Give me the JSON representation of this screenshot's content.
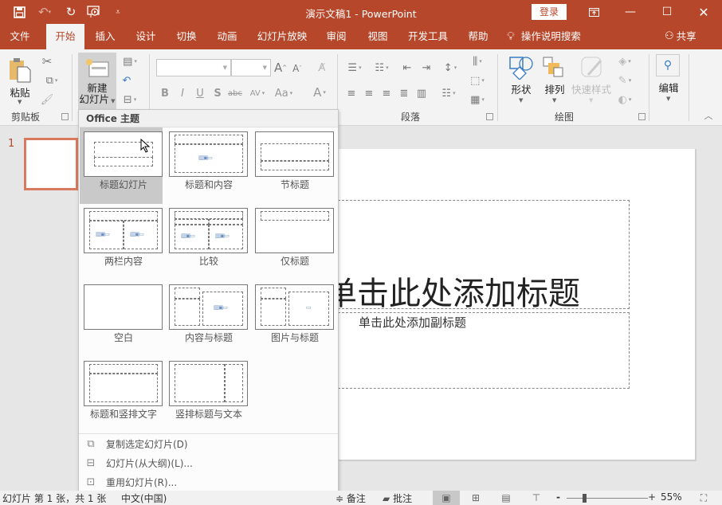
{
  "titlebar": {
    "document_title": "演示文稿1 - PowerPoint",
    "login_label": "登录",
    "qat": {
      "save": "save-icon",
      "undo": "undo-icon",
      "redo": "redo-icon",
      "present": "present-from-start-icon",
      "customize": "customize-qat-icon"
    },
    "window_buttons": {
      "ribbon_display": "ribbon-display-options-icon",
      "minimize": "minimize-icon",
      "maximize": "maximize-icon",
      "close": "close-icon"
    }
  },
  "tabs": [
    {
      "label": "文件",
      "active": false
    },
    {
      "label": "开始",
      "active": true
    },
    {
      "label": "插入",
      "active": false
    },
    {
      "label": "设计",
      "active": false
    },
    {
      "label": "切换",
      "active": false
    },
    {
      "label": "动画",
      "active": false
    },
    {
      "label": "幻灯片放映",
      "active": false
    },
    {
      "label": "审阅",
      "active": false
    },
    {
      "label": "视图",
      "active": false
    },
    {
      "label": "开发工具",
      "active": false
    },
    {
      "label": "帮助",
      "active": false
    }
  ],
  "tell_me": {
    "label": "操作说明搜索"
  },
  "share": {
    "label": "共享"
  },
  "ribbon": {
    "clipboard": {
      "group_label": "剪贴板",
      "paste_label": "粘贴"
    },
    "slides": {
      "new_slide_label_line1": "新建",
      "new_slide_label_line2": "幻灯片"
    },
    "font": {
      "font_name": "",
      "font_size": ""
    },
    "paragraph": {
      "group_label": "段落"
    },
    "drawing": {
      "group_label": "绘图",
      "shapes_label": "形状",
      "arrange_label": "排列",
      "quick_styles_label": "快速样式"
    },
    "editing": {
      "label": "编辑"
    }
  },
  "layout_gallery": {
    "header": "Office 主题",
    "layouts": [
      {
        "label": "标题幻灯片",
        "selected": true
      },
      {
        "label": "标题和内容",
        "selected": false
      },
      {
        "label": "节标题",
        "selected": false
      },
      {
        "label": "两栏内容",
        "selected": false
      },
      {
        "label": "比较",
        "selected": false
      },
      {
        "label": "仅标题",
        "selected": false
      },
      {
        "label": "空白",
        "selected": false
      },
      {
        "label": "内容与标题",
        "selected": false
      },
      {
        "label": "图片与标题",
        "selected": false
      },
      {
        "label": "标题和竖排文字",
        "selected": false
      },
      {
        "label": "竖排标题与文本",
        "selected": false
      }
    ],
    "menu_items": [
      {
        "label": "复制选定幻灯片(D)",
        "icon": "duplicate-slide-icon"
      },
      {
        "label": "幻灯片(从大纲)(L)...",
        "icon": "slides-from-outline-icon"
      },
      {
        "label": "重用幻灯片(R)...",
        "icon": "reuse-slides-icon"
      }
    ]
  },
  "thumbnails": [
    {
      "number": "1"
    }
  ],
  "slide": {
    "title_placeholder": "单击此处添加标题",
    "subtitle_placeholder": "单击此处添加副标题"
  },
  "statusbar": {
    "slide_info": "幻灯片 第 1 张，共 1 张",
    "language": "中文(中国)",
    "notes_label": "备注",
    "comments_label": "批注",
    "zoom_percent": "55%",
    "zoom_value": 55
  },
  "colors": {
    "accent": "#b7472a",
    "thumb_selected": "#d9795d"
  }
}
